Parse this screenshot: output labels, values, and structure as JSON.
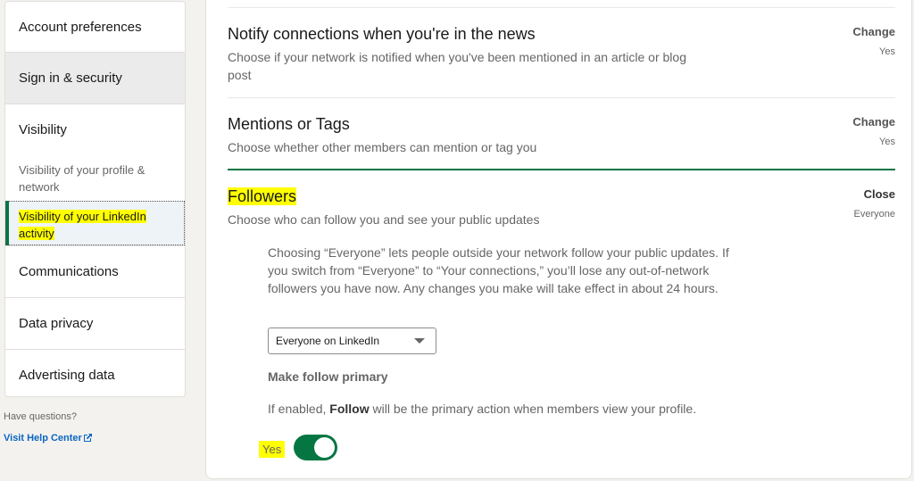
{
  "sidebar": {
    "items": [
      {
        "label": "Account preferences"
      },
      {
        "label": "Sign in & security"
      },
      {
        "label": "Visibility"
      },
      {
        "label": "Communications"
      },
      {
        "label": "Data privacy"
      },
      {
        "label": "Advertising data"
      }
    ],
    "visibility_subitems": [
      {
        "label": "Visibility of your profile & network"
      },
      {
        "label": "Visibility of your LinkedIn activity",
        "active": true
      }
    ],
    "help_question": "Have questions?",
    "help_link": "Visit Help Center",
    "help_link_icon": "external-link-icon"
  },
  "settings": [
    {
      "title": "Notify connections when you're in the news",
      "description": "Choose if your network is notified when you've been mentioned in an article or blog post",
      "action": "Change",
      "value": "Yes"
    },
    {
      "title": "Mentions or Tags",
      "description": "Choose whether other members can mention or tag you",
      "action": "Change",
      "value": "Yes"
    },
    {
      "title": "Followers",
      "description": "Choose who can follow you and see your public updates",
      "action": "Close",
      "value": "Everyone",
      "expanded": {
        "info": "Choosing “Everyone” lets people outside your network follow your public updates. If you switch from “Everyone” to “Your connections,” you’ll lose any out-of-network followers you have now. Any changes you make will take effect in about 24 hours.",
        "select_value": "Everyone on LinkedIn",
        "make_follow_primary_label": "Make follow primary",
        "make_follow_primary_desc_prefix": "If enabled, ",
        "make_follow_primary_desc_bold": "Follow",
        "make_follow_primary_desc_suffix": " will be the primary action when members view your profile.",
        "toggle_label": "Yes",
        "toggle_on": true
      }
    }
  ],
  "colors": {
    "accent_green": "#057642",
    "highlight": "#ffff00",
    "link_blue": "#0a66c2"
  }
}
